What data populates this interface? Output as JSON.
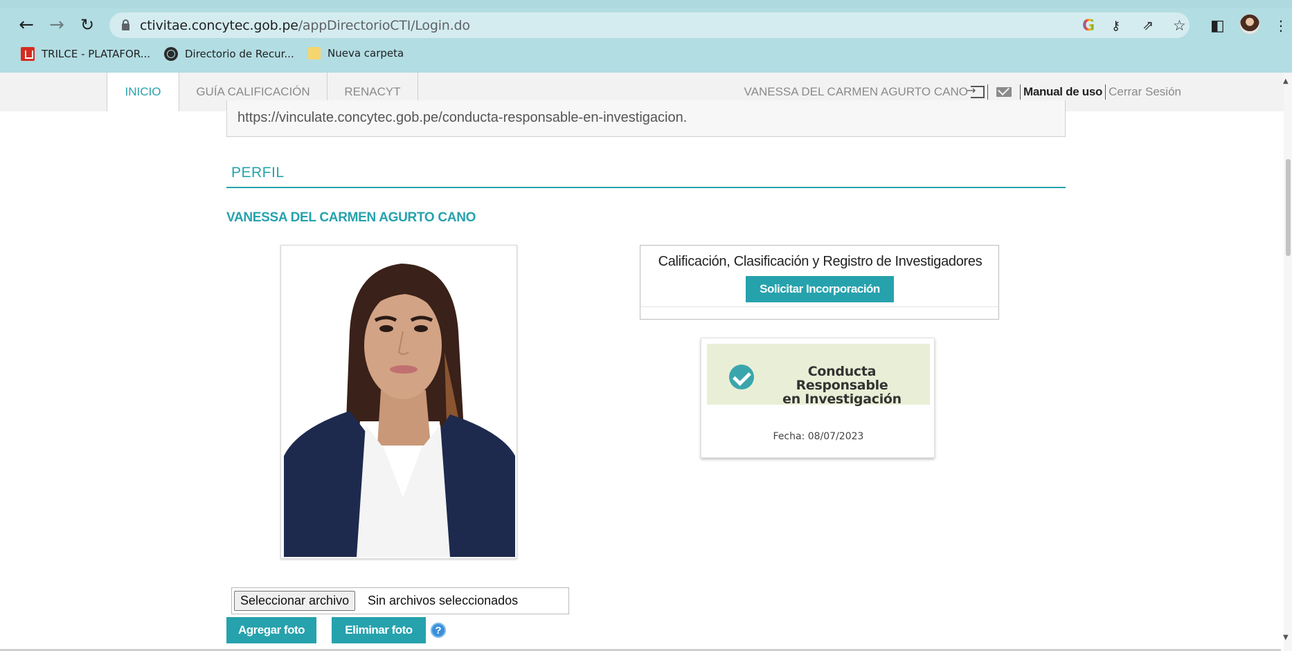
{
  "browser": {
    "url_domain": "ctivitae.concytec.gob.pe",
    "url_path": "/appDirectorioCTI/Login.do",
    "bookmarks": [
      {
        "label": "TRILCE - PLATAFOR...",
        "icon": "trilce-icon"
      },
      {
        "label": "Directorio de Recur...",
        "icon": "globe-icon"
      },
      {
        "label": "Nueva carpeta",
        "icon": "folder-icon"
      }
    ],
    "icons": [
      "back-icon",
      "forward-icon",
      "reload-icon",
      "lock-icon",
      "google-icon",
      "key-icon",
      "share-icon",
      "star-icon",
      "sidebar-icon",
      "profile-avatar",
      "menu-icon"
    ]
  },
  "navbar": {
    "tabs": [
      {
        "label": "INICIO",
        "active": true
      },
      {
        "label": "GUÍA CALIFICACIÓN",
        "active": false
      },
      {
        "label": "RENACYT",
        "active": false
      }
    ],
    "user_name": "VANESSA DEL CARMEN AGURTO CANO",
    "manual_label": "Manual de uso",
    "logout_label": "Cerrar Sesión"
  },
  "content": {
    "url_text": "https://vinculate.concytec.gob.pe/conducta-responsable-en-investigacion.",
    "section_title": "PERFIL",
    "person_name": "VANESSA DEL CARMEN AGURTO CANO",
    "calificacion": {
      "title": "Calificación, Clasificación y Registro de Investigadores",
      "button_label": "Solicitar Incorporación"
    },
    "badge": {
      "line1": "Conducta Responsable",
      "line2": "en Investigación",
      "date": "Fecha: 08/07/2023"
    },
    "file": {
      "button_label": "Seleccionar archivo",
      "status": "Sin archivos seleccionados"
    },
    "actions": {
      "add_photo": "Agregar foto",
      "delete_photo": "Eliminar foto",
      "help": "?"
    }
  },
  "colors": {
    "accent": "#26a2ad",
    "chrome_bg": "#b2dde2",
    "navbar_bg": "#f2f2f2"
  }
}
